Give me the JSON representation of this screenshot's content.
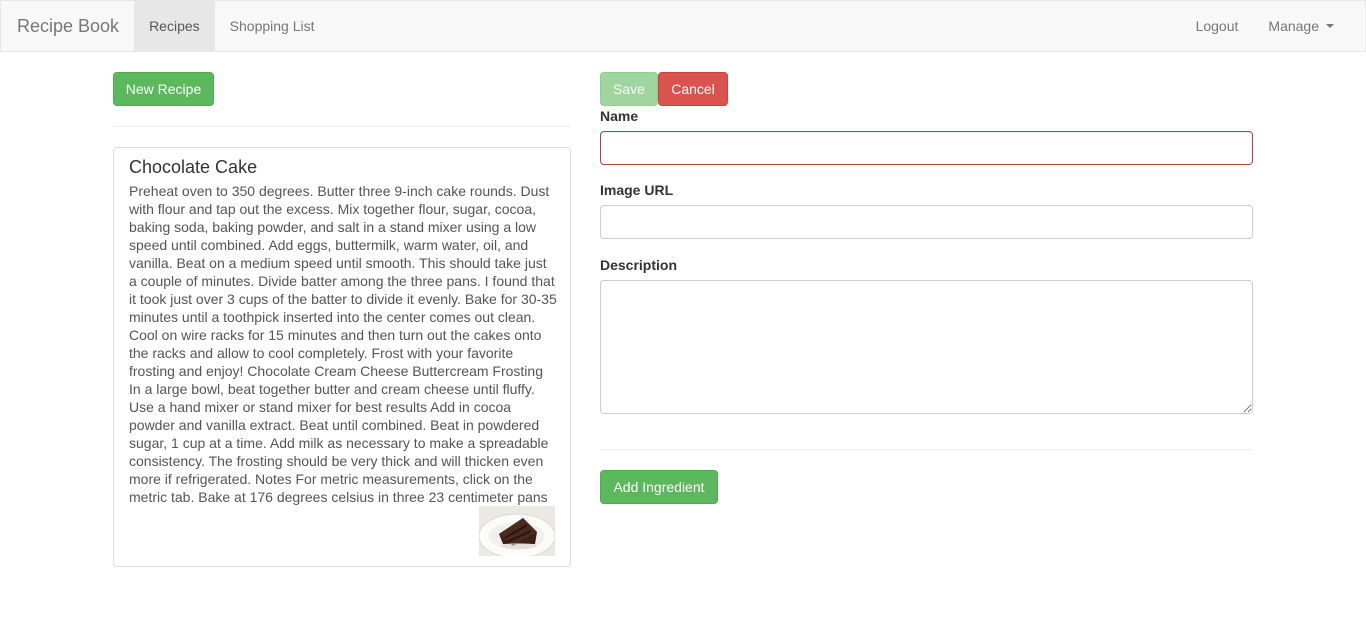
{
  "navbar": {
    "brand": "Recipe Book",
    "links": [
      "Recipes",
      "Shopping List"
    ],
    "right": {
      "logout": "Logout",
      "manage": "Manage"
    }
  },
  "left": {
    "new_recipe_label": "New Recipe",
    "recipe": {
      "title": "Chocolate Cake",
      "description": "Preheat oven to 350 degrees. Butter three 9-inch cake rounds. Dust with flour and tap out the excess. Mix together flour, sugar, cocoa, baking soda, baking powder, and salt in a stand mixer using a low speed until combined. Add eggs, buttermilk, warm water, oil, and vanilla. Beat on a medium speed until smooth. This should take just a couple of minutes. Divide batter among the three pans. I found that it took just over 3 cups of the batter to divide it evenly. Bake for 30-35 minutes until a toothpick inserted into the center comes out clean. Cool on wire racks for 15 minutes and then turn out the cakes onto the racks and allow to cool completely. Frost with your favorite frosting and enjoy! Chocolate Cream Cheese Buttercream Frosting In a large bowl, beat together butter and cream cheese until fluffy. Use a hand mixer or stand mixer for best results Add in cocoa powder and vanilla extract. Beat until combined. Beat in powdered sugar, 1 cup at a time. Add milk as necessary to make a spreadable consistency. The frosting should be very thick and will thicken even more if refrigerated. Notes For metric measurements, click on the metric tab. Bake at 176 degrees celsius in three 23 centimeter pans",
      "image": "chocolate-cake-slice-thumbnail"
    }
  },
  "form": {
    "save_label": "Save",
    "cancel_label": "Cancel",
    "name_label": "Name",
    "name_value": "",
    "image_url_label": "Image URL",
    "image_url_value": "",
    "description_label": "Description",
    "description_value": "",
    "add_ingredient_label": "Add Ingredient"
  },
  "colors": {
    "success": "#5cb85c",
    "danger": "#d9534f",
    "invalid_border": "#a94442"
  }
}
